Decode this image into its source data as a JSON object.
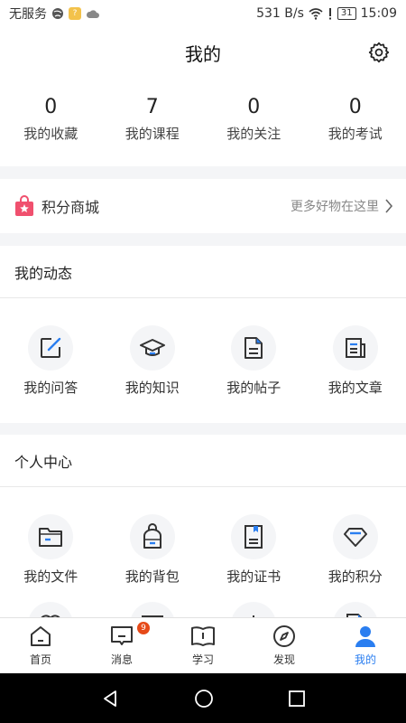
{
  "status_bar": {
    "carrier": "无服务",
    "network_speed": "531 B/s",
    "battery": "31",
    "time": "15:09",
    "notification_badge": "?"
  },
  "header": {
    "title": "我的"
  },
  "stats": [
    {
      "value": "0",
      "label": "我的收藏"
    },
    {
      "value": "7",
      "label": "我的课程"
    },
    {
      "value": "0",
      "label": "我的关注"
    },
    {
      "value": "0",
      "label": "我的考试"
    }
  ],
  "mall": {
    "title": "积分商城",
    "link": "更多好物在这里"
  },
  "activity": {
    "title": "我的动态",
    "items": [
      {
        "label": "我的问答",
        "icon": "edit-icon"
      },
      {
        "label": "我的知识",
        "icon": "graduation-cap-icon"
      },
      {
        "label": "我的帖子",
        "icon": "post-icon"
      },
      {
        "label": "我的文章",
        "icon": "article-icon"
      }
    ]
  },
  "personal": {
    "title": "个人中心",
    "items": [
      {
        "label": "我的文件",
        "icon": "folder-icon"
      },
      {
        "label": "我的背包",
        "icon": "backpack-icon"
      },
      {
        "label": "我的证书",
        "icon": "certificate-icon"
      },
      {
        "label": "我的积分",
        "icon": "diamond-icon"
      }
    ]
  },
  "tabbar": {
    "tabs": [
      {
        "label": "首页",
        "icon": "home-icon"
      },
      {
        "label": "消息",
        "icon": "message-icon",
        "badge": "9"
      },
      {
        "label": "学习",
        "icon": "book-icon"
      },
      {
        "label": "发现",
        "icon": "compass-icon"
      },
      {
        "label": "我的",
        "icon": "user-icon",
        "active": true
      }
    ]
  },
  "colors": {
    "accent": "#2a7ef0",
    "badge": "#e64a19",
    "mall_icon": "#f0506e"
  }
}
